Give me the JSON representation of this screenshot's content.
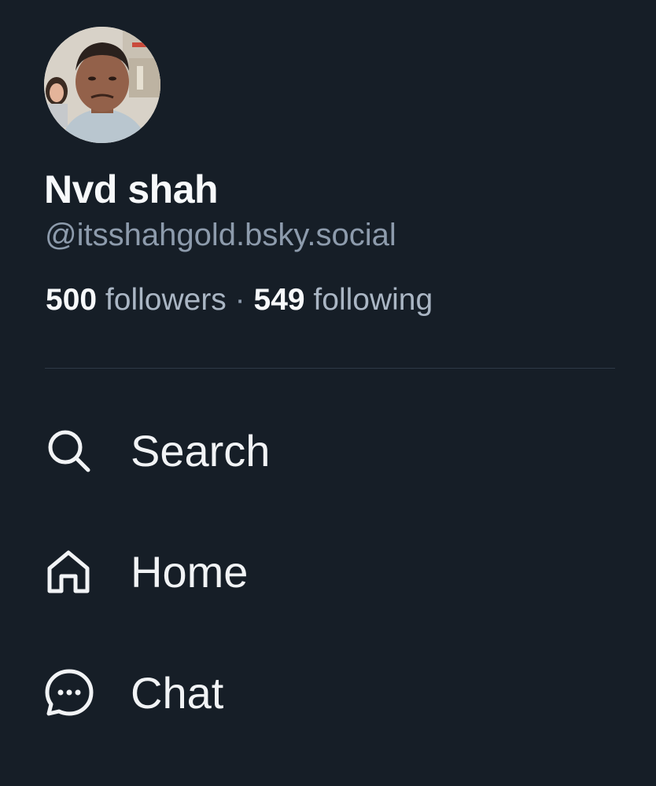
{
  "profile": {
    "display_name": "Nvd shah",
    "handle": "@itsshahgold.bsky.social",
    "followers_count": "500",
    "followers_label": "followers",
    "separator": "·",
    "following_count": "549",
    "following_label": "following"
  },
  "nav": {
    "items": [
      {
        "label": "Search",
        "icon": "search-icon"
      },
      {
        "label": "Home",
        "icon": "home-icon"
      },
      {
        "label": "Chat",
        "icon": "chat-icon"
      }
    ]
  },
  "colors": {
    "background": "#161e27",
    "primary_text": "#f1f3f5",
    "secondary_text": "#8d9bac",
    "divider": "#2e3946"
  }
}
